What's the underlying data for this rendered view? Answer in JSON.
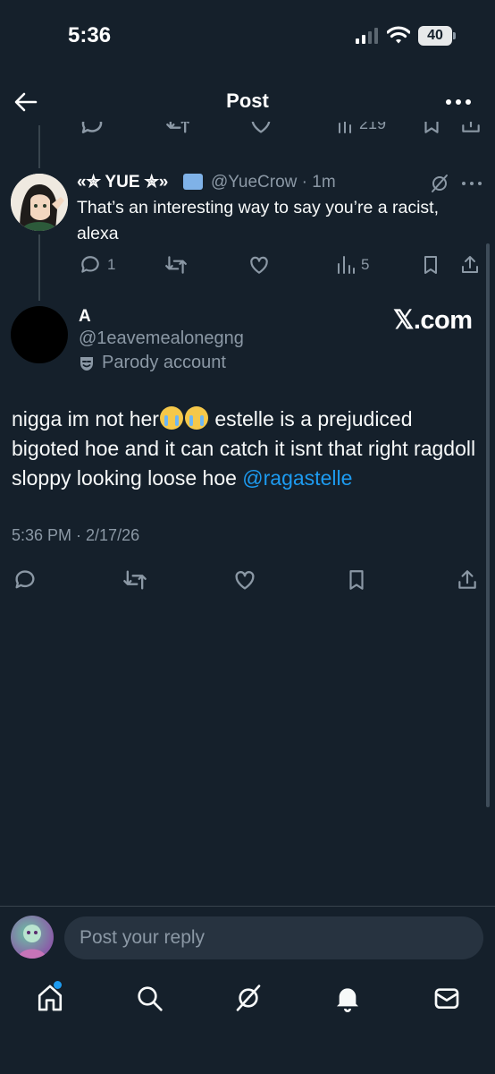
{
  "status_bar": {
    "time": "5:36",
    "battery": "40"
  },
  "header": {
    "title": "Post"
  },
  "reply": {
    "name": "«✮ YUE ✮»",
    "handle": "@YueCrow",
    "time": "· 1m",
    "text": "That’s an interesting way to say you’re a racist, alexa",
    "replies": "1",
    "views": "5"
  },
  "post": {
    "name": "A",
    "handle": "@1eavemealonegng",
    "parody_label": "Parody account",
    "watermark": "𝕏.com",
    "text_part1": "nigga im not her",
    "text_part2": " estelle is a prejudiced bigoted hoe and it can catch it isnt that right ragdoll sloppy looking loose hoe ",
    "mention": "@ragastelle",
    "timestamp": "5:36 PM · 2/17/26"
  },
  "composer": {
    "placeholder": "Post your reply"
  },
  "icons": [
    "back-arrow-icon",
    "more-icon",
    "grok-icon",
    "reply-icon",
    "repost-icon",
    "like-icon",
    "views-icon",
    "bookmark-icon",
    "share-icon",
    "home-icon",
    "search-icon",
    "notifications-icon",
    "messages-icon",
    "parody-mask-icon",
    "emoji-loudly-crying"
  ],
  "colors": {
    "background": "#15202b",
    "accent": "#1d9bf0",
    "muted": "#8b98a5"
  }
}
